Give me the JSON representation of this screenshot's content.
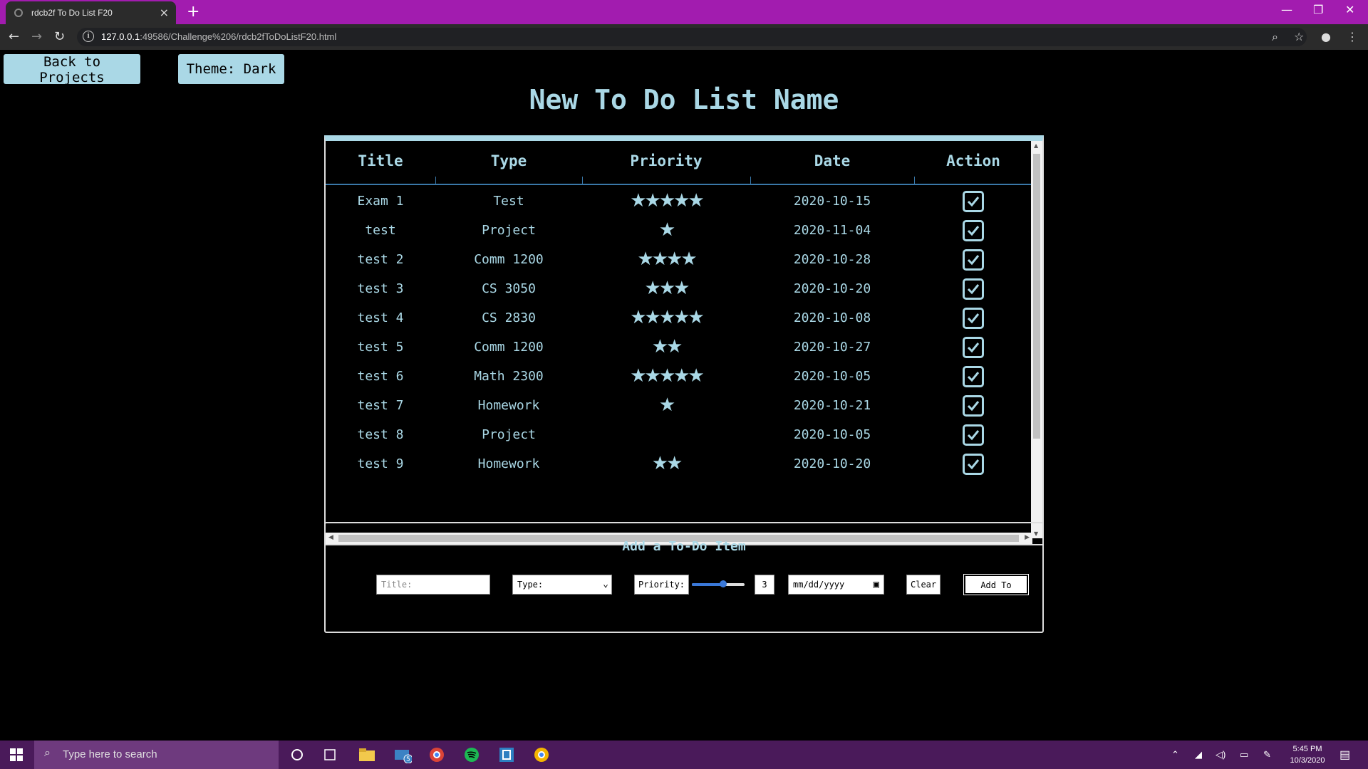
{
  "browser": {
    "tab_title": "rdcb2f To Do List F20",
    "url_host": "127.0.0.1",
    "url_rest": ":49586/Challenge%206/rdcb2fToDoListF20.html"
  },
  "page": {
    "back_button": "Back to Projects",
    "theme_button": "Theme: Dark",
    "title": "New To Do List Name"
  },
  "table": {
    "columns": [
      "Title",
      "Type",
      "Priority",
      "Date",
      "Action"
    ],
    "rows": [
      {
        "title": "Exam 1",
        "type": "Test",
        "priority": 5,
        "date": "2020-10-15",
        "done": true
      },
      {
        "title": "test",
        "type": "Project",
        "priority": 1,
        "date": "2020-11-04",
        "done": true
      },
      {
        "title": "test 2",
        "type": "Comm 1200",
        "priority": 4,
        "date": "2020-10-28",
        "done": true
      },
      {
        "title": "test 3",
        "type": "CS 3050",
        "priority": 3,
        "date": "2020-10-20",
        "done": true
      },
      {
        "title": "test 4",
        "type": "CS 2830",
        "priority": 5,
        "date": "2020-10-08",
        "done": true
      },
      {
        "title": "test 5",
        "type": "Comm 1200",
        "priority": 2,
        "date": "2020-10-27",
        "done": true
      },
      {
        "title": "test 6",
        "type": "Math 2300",
        "priority": 5,
        "date": "2020-10-05",
        "done": true
      },
      {
        "title": "test 7",
        "type": "Homework",
        "priority": 1,
        "date": "2020-10-21",
        "done": true
      },
      {
        "title": "test 8",
        "type": "Project",
        "priority": 0,
        "date": "2020-10-05",
        "done": true
      },
      {
        "title": "test 9",
        "type": "Homework",
        "priority": 2,
        "date": "2020-10-20",
        "done": true
      }
    ]
  },
  "form": {
    "heading": "Add a To-Do Item",
    "title_placeholder": "Title:",
    "type_select": "Type:",
    "priority_label": "Priority:",
    "priority_value": "3",
    "priority_fraction": 0.6,
    "date_placeholder": "mm/dd/yyyy",
    "clear_button": "Clear",
    "add_button": "Add To List"
  },
  "taskbar": {
    "search_placeholder": "Type here to search",
    "mail_badge": "5",
    "time": "5:45 PM",
    "date": "10/3/2020"
  },
  "colors": {
    "accent": "#aad8e6",
    "tabbar": "#a21caf",
    "background": "#000000"
  }
}
